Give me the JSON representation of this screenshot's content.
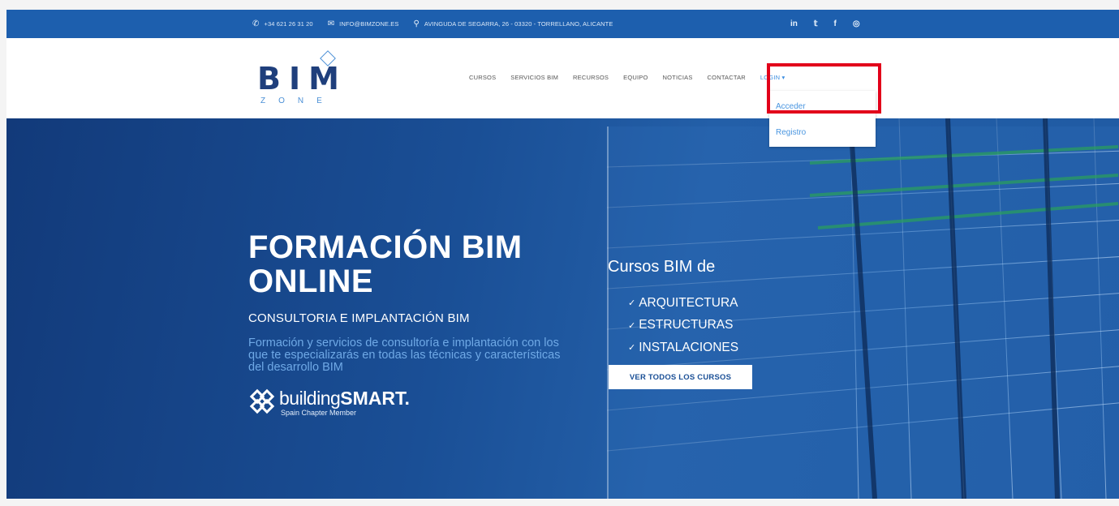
{
  "topbar": {
    "phone": "+34 621 26 31 20",
    "email": "INFO@BIMZONE.ES",
    "address": "AVINGUDA DE SEGARRA, 26 - 03320 - TORRELLANO, ALICANTE",
    "social_linkedin": "in",
    "social_twitter": "𝕥",
    "social_facebook": "f",
    "social_instagram": "◎"
  },
  "logo": {
    "mark": "BIM",
    "sub": "ZONE"
  },
  "nav": {
    "items": [
      "CURSOS",
      "SERVICIOS BIM",
      "RECURSOS",
      "EQUIPO",
      "NOTICIAS",
      "CONTACTAR"
    ],
    "login": "LOGIN ▾"
  },
  "dropdown": {
    "items": [
      "Acceder",
      "Registro"
    ]
  },
  "hero": {
    "title_line1": "FORMACIÓN BIM",
    "title_line2": "ONLINE",
    "subtitle": "CONSULTORIA E IMPLANTACIÓN BIM",
    "description": "Formación y servicios de consultoría e implantación con los que te especializarás en todas las técnicas y características del desarrollo BIM",
    "building_smart": "building",
    "building_smart_bold": "SMART.",
    "chapter": "Spain Chapter Member",
    "courses_title": "Cursos BIM de",
    "courses": [
      "ARQUITECTURA",
      "ESTRUCTURAS",
      "INSTALACIONES"
    ],
    "check": "✓",
    "cta": "VER TODOS LOS CURSOS"
  },
  "colors": {
    "topbar": "#1d5fae",
    "hero_dark": "#123a7a",
    "accent": "#3b8de0",
    "highlight": "#e2001a"
  }
}
